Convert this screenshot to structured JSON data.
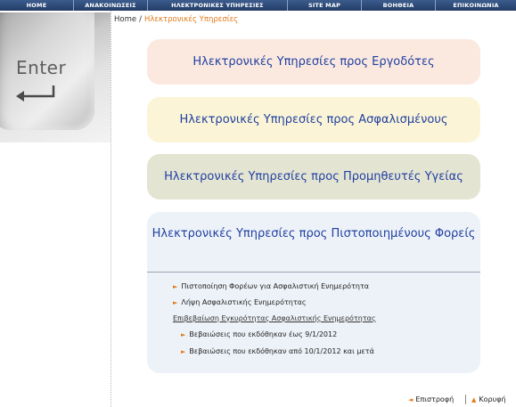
{
  "nav": {
    "items": [
      "HOME",
      "ΑΝΑΚΟΙΝΩΣΕΙΣ",
      "ΗΛΕΚΤΡΟΝΙΚΕΣ ΥΠΗΡΕΣΙΕΣ",
      "SITE MAP",
      "ΒΟΗΘΕΙΑ",
      "ΕΠΙΚΟΙΝΩΝΙΑ"
    ]
  },
  "side_image": {
    "key_label": "Enter"
  },
  "breadcrumb": {
    "home": "Home",
    "separator": "/",
    "current": "Ηλεκτρονικές Υπηρεσίες"
  },
  "services": {
    "employers": "Ηλεκτρονικές Υπηρεσίες προς Εργοδότες",
    "insured": "Ηλεκτρονικές Υπηρεσίες προς Ασφαλισμένους",
    "health_suppliers": "Ηλεκτρονικές Υπηρεσίες προς Προμηθευτές Υγείας",
    "certified_bodies": {
      "title": "Ηλεκτρονικές Υπηρεσίες προς Πιστοποιημένους Φορείς",
      "links": [
        "Πιστοποίηση Φορέων για Ασφαλιστική Ενημερότητα",
        "Λήψη Ασφαλιστικής Ενημερότητας"
      ],
      "verify_heading": "Επιβεβαίωση Εγκυρότητας Ασφαλιστικής Ενημερότητας",
      "verify_links": [
        "Βεβαιώσεις που εκδόθηκαν έως 9/1/2012",
        "Βεβαιώσεις που εκδόθηκαν από 10/1/2012 και μετά"
      ]
    }
  },
  "footer": {
    "back": "Επιστροφή",
    "top": "Κορυφή"
  }
}
